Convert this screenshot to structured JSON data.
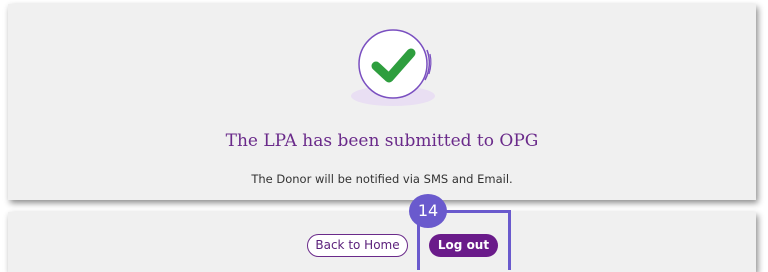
{
  "confirmation": {
    "title": "The LPA has been submitted to OPG",
    "message": "The Donor will be notified via SMS and Email.",
    "icon": "check-circle-icon"
  },
  "actions": {
    "back_home_label": "Back to Home",
    "logout_label": "Log out"
  },
  "annotation": {
    "step_number": "14"
  },
  "colors": {
    "brand_purple": "#6a1b8a",
    "check_green": "#2e9e3e",
    "annotation_blue": "#6a5acd",
    "card_bg": "#f0f0f0"
  }
}
